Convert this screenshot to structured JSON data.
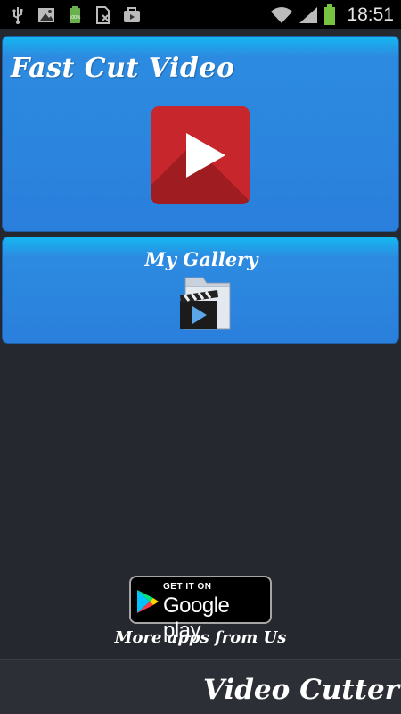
{
  "status_bar": {
    "time": "18:51",
    "icons": [
      "usb-icon",
      "image-notification-icon",
      "battery-full-notification-icon",
      "sim-blocked-icon",
      "briefcase-notification-icon",
      "wifi-icon",
      "signal-icon",
      "battery-icon"
    ],
    "battery_badge": "100%"
  },
  "main": {
    "fast_cut": {
      "title": "Fast Cut Video",
      "icon": "play-icon"
    },
    "gallery": {
      "title": "My Gallery",
      "icon": "video-folder-icon"
    }
  },
  "promo": {
    "badge_small": "GET IT ON",
    "badge_big": "Google play",
    "badge_icon": "google-play-logo-icon",
    "caption": "More apps from Us"
  },
  "bottom_bar": {
    "title": "Video Cutter"
  },
  "colors": {
    "card_blue": "#2a7fdc",
    "card_highlight": "#15b7f3",
    "play_red": "#c8262d",
    "background": "#25282e"
  }
}
